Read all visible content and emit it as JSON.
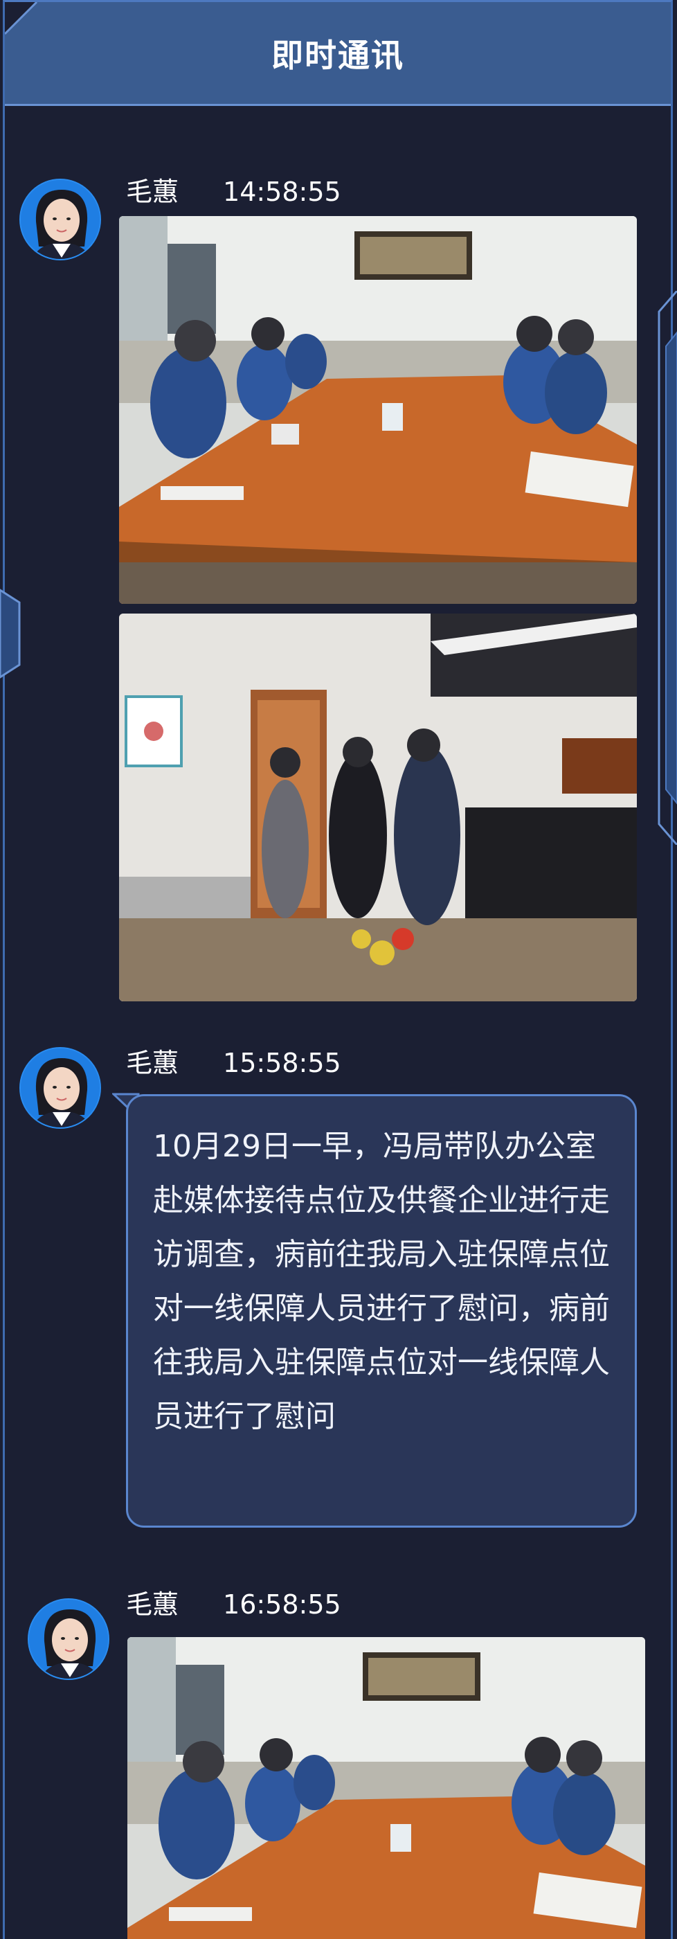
{
  "header": {
    "title": "即时通讯"
  },
  "messages": [
    {
      "sender": "毛蕙",
      "time": "14:58:55",
      "type": "photos",
      "photos": [
        "meeting-room-photo",
        "office-visit-photo"
      ]
    },
    {
      "sender": "毛蕙",
      "time": "15:58:55",
      "type": "text",
      "text": "10月29日一早，冯局带队办公室赴媒体接待点位及供餐企业进行走访调查，病前往我局入驻保障点位对一线保障人员进行了慰问，病前往我局入驻保障点位对一线保障人员进行了慰问"
    },
    {
      "sender": "毛蕙",
      "time": "16:58:55",
      "type": "photos",
      "photos": [
        "meeting-room-photo"
      ]
    }
  ],
  "colors": {
    "background": "#1b1f33",
    "header": "#3a5c90",
    "frame": "#3f6bb0",
    "bubble": "#2a3658",
    "bubble_border": "#5a86cf",
    "avatar_bg": "#1f7ee3"
  }
}
